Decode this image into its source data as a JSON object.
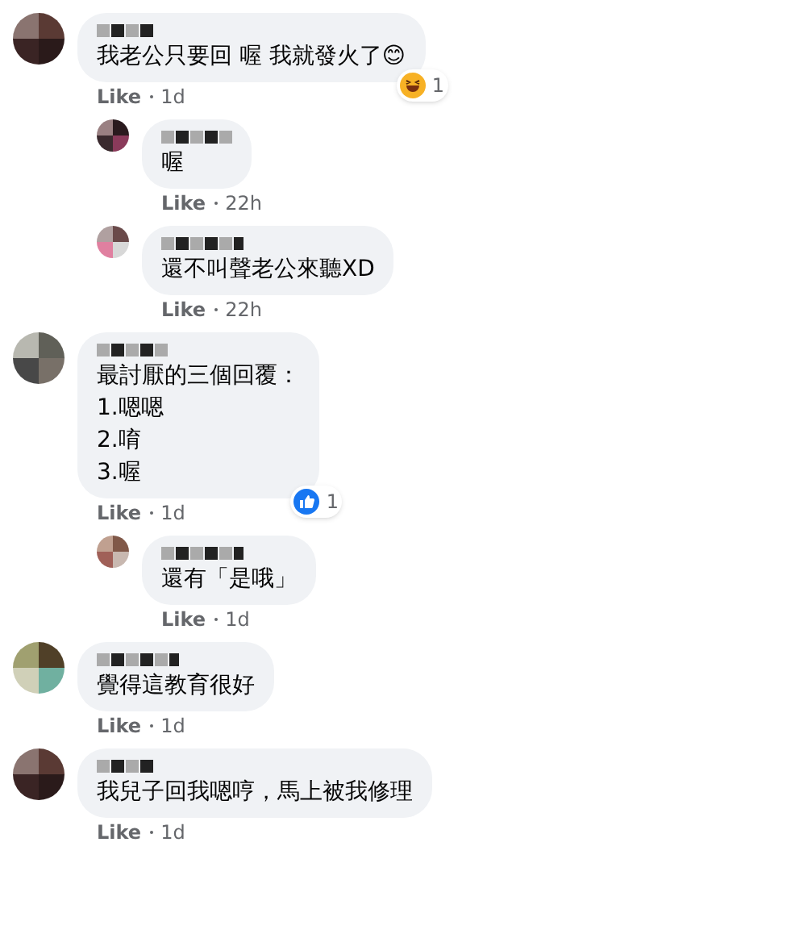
{
  "comments": [
    {
      "lines": [
        "我老公只要回 喔 我就發火了😊"
      ],
      "reaction": {
        "kind": "haha",
        "count": "1"
      },
      "like": "Like",
      "time": "1d",
      "replies": [
        {
          "lines": [
            "喔"
          ],
          "like": "Like",
          "time": "22h"
        },
        {
          "lines": [
            "還不叫聲老公來聽XD"
          ],
          "like": "Like",
          "time": "22h"
        }
      ]
    },
    {
      "lines": [
        "最討厭的三個回覆：",
        "1.嗯嗯",
        "2.唷",
        "3.喔"
      ],
      "reaction": {
        "kind": "like",
        "count": "1"
      },
      "like": "Like",
      "time": "1d",
      "replies": [
        {
          "lines": [
            "還有「是哦」"
          ],
          "like": "Like",
          "time": "1d"
        }
      ]
    },
    {
      "lines": [
        "覺得這教育很好"
      ],
      "like": "Like",
      "time": "1d"
    },
    {
      "lines": [
        "我兒子回我嗯哼，馬上被我修理"
      ],
      "like": "Like",
      "time": "1d"
    }
  ]
}
